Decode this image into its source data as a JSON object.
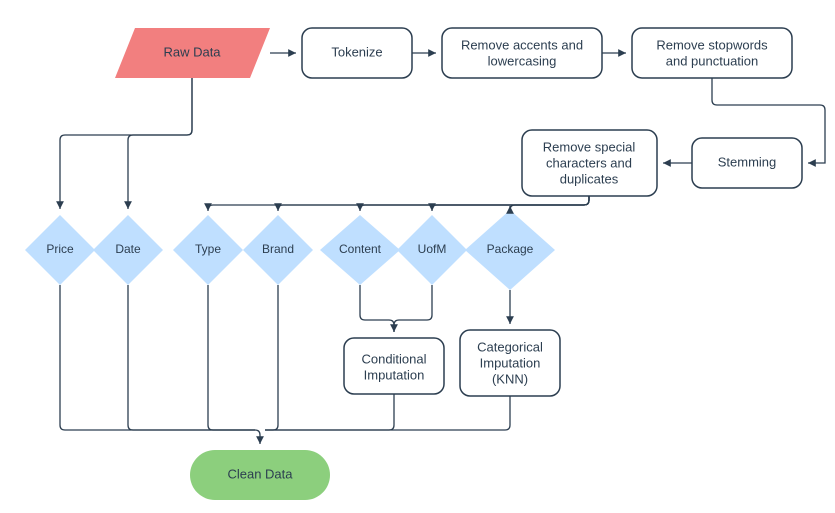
{
  "nodes": {
    "raw_data": "Raw Data",
    "tokenize": "Tokenize",
    "remove_accents_l1": "Remove accents and",
    "remove_accents_l2": "lowercasing",
    "remove_stopwords_l1": "Remove stopwords",
    "remove_stopwords_l2": "and punctuation",
    "stemming": "Stemming",
    "remove_special_l1": "Remove special",
    "remove_special_l2": "characters and",
    "remove_special_l3": "duplicates",
    "price": "Price",
    "date": "Date",
    "type": "Type",
    "brand": "Brand",
    "content": "Content",
    "uofm": "UofM",
    "package": "Package",
    "conditional_l1": "Conditional",
    "conditional_l2": "Imputation",
    "categorical_l1": "Categorical",
    "categorical_l2": "Imputation",
    "categorical_l3": "(KNN)",
    "clean_data": "Clean Data"
  },
  "colors": {
    "raw_fill": "#F27F7F",
    "process_stroke": "#2c3e50",
    "diamond_fill": "#BFDFFF",
    "clean_fill": "#8CCF7D",
    "arrow": "#2c3e50"
  }
}
